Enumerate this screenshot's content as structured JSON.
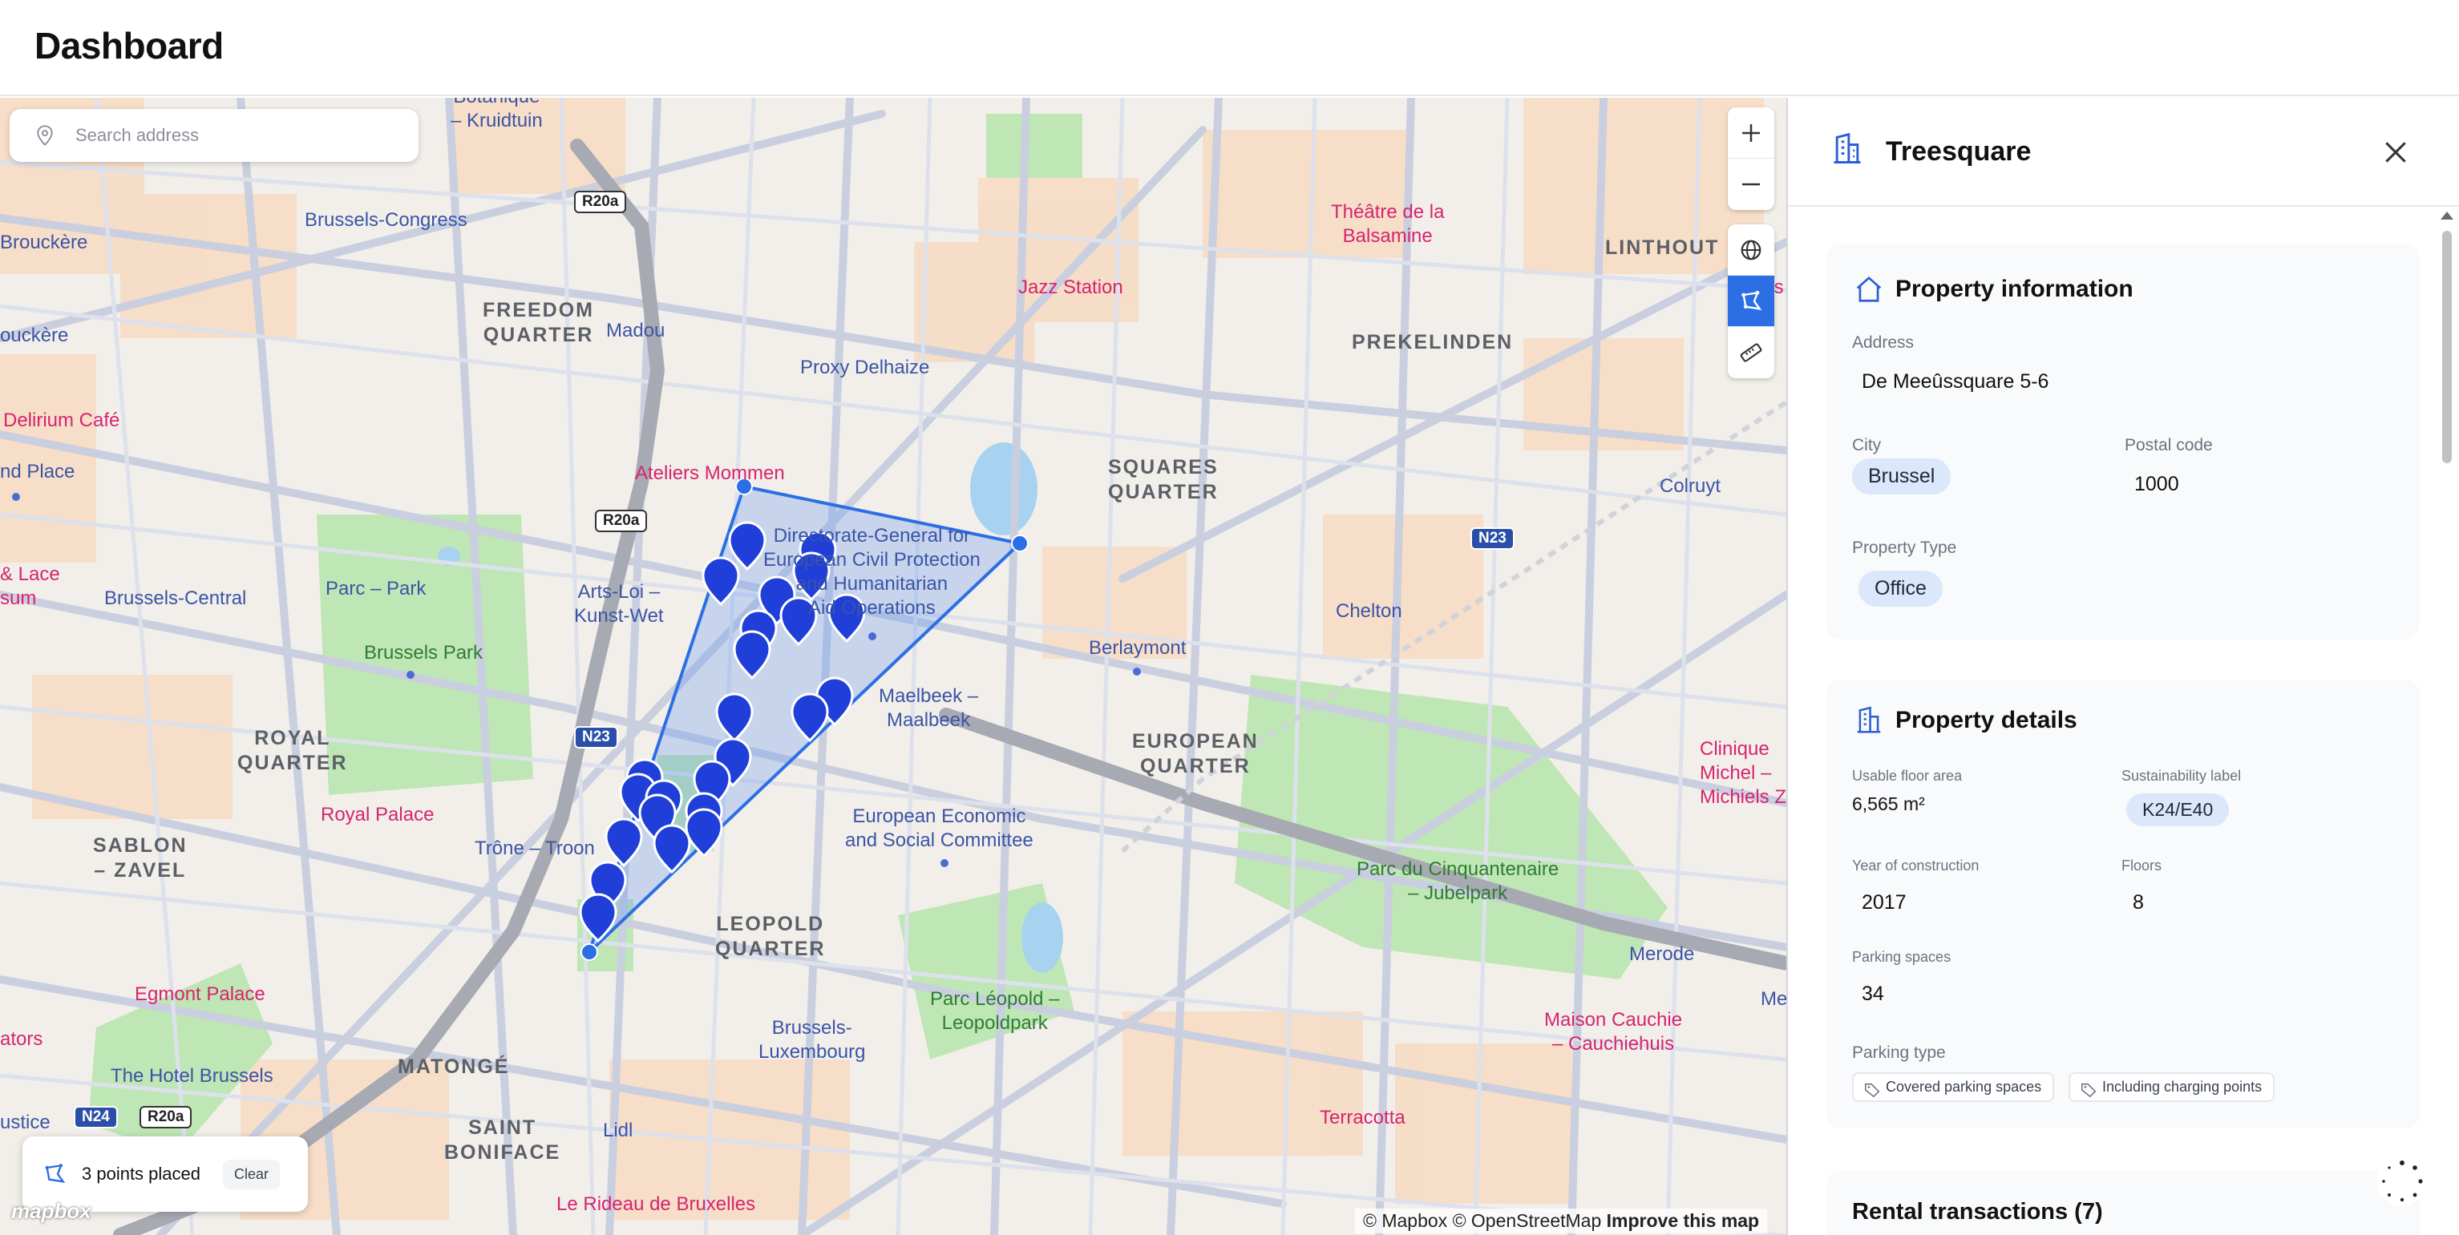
{
  "header": {
    "title": "Dashboard"
  },
  "search": {
    "placeholder": "Search address",
    "icon": "location-pin-icon"
  },
  "map_controls": {
    "items": [
      {
        "name": "zoom-in",
        "icon": "plus-icon"
      },
      {
        "name": "zoom-out",
        "icon": "minus-icon"
      },
      {
        "name": "globe",
        "icon": "globe-icon"
      },
      {
        "name": "draw-polygon",
        "icon": "polygon-draw-icon",
        "active": true
      },
      {
        "name": "measure",
        "icon": "ruler-icon"
      }
    ]
  },
  "map": {
    "labels": {
      "bolanique": "Botanique\n– Kruidtuin",
      "brouckere": "Brouckère",
      "brouckere2": "ouckère",
      "brussels_congress": "Brussels-Congress",
      "freedom_quarter": "FREEDOM\nQUARTER",
      "madou": "Madou",
      "delirium": "Delirium Café",
      "nd_place": "nd Place",
      "proxy_delhaize": "Proxy Delhaize",
      "jazz_station": "Jazz Station",
      "theatre": "Théâtre de la\nBalsamine",
      "linthout": "LINTHOUT",
      "los": "L'Os",
      "prekelinden": "PREKELINDEN",
      "ateliers": "Ateliers Mommen",
      "squares_quarter": "SQUARES\nQUARTER",
      "colruyt": "Colruyt",
      "lace": "& Lace\nsum",
      "brussels_central": "Brussels-Central",
      "parc_park": "Parc – Park",
      "arts_loi": "Arts-Loi –\nKunst-Wet",
      "dg": "Directorate-General for\nEuropean Civil Protection\nand Humanitarian\nAid Operations",
      "chelton": "Chelton",
      "brussels_park": "Brussels Park",
      "berlaymont": "Berlaymont",
      "maelbeek": "Maelbeek –\nMaalbeek",
      "royal_quarter": "ROYAL\nQUARTER",
      "european_quarter": "EUROPEAN\nQUARTER",
      "clinique": "Clinique\nMichel –\nMichiels Zie",
      "royal_palace": "Royal Palace",
      "eesc": "European Economic\nand Social Committee",
      "sablon": "SABLON\n– ZAVEL",
      "trone": "Trône – Troon",
      "cinquantenaire": "Parc du Cinquantenaire\n– Jubelpark",
      "leopold_quarter": "LEOPOLD\nQUARTER",
      "merode": "Merode",
      "egmont": "Egmont Palace",
      "parc_leopold": "Parc Léopold –\nLeopoldpark",
      "brussels_luxembourg": "Brussels-\nLuxembourg",
      "me": "Me",
      "ators": "ators",
      "hotel_brussels": "The Hotel Brussels",
      "matonge": "MATONGÉ",
      "maison_cauchie": "Maison Cauchie\n– Cauchiehuis",
      "ustice": "ustice",
      "saint_boniface": "SAINT\nBONIFACE",
      "lidl": "Lidl",
      "terracotta": "Terracotta",
      "rideau": "Le Rideau de Bruxelles"
    },
    "road_badges": [
      "R20a",
      "R20a",
      "N23",
      "N23",
      "N24",
      "R20a"
    ],
    "attribution": {
      "a": "© Mapbox",
      "b": "© OpenStreetMap",
      "c": "Improve this map"
    },
    "logo": "mapbox"
  },
  "points_box": {
    "text": "3 points placed",
    "clear_label": "Clear"
  },
  "panel": {
    "title": "Treesquare",
    "property_information": {
      "title": "Property information",
      "address_label": "Address",
      "address": "De Meeûssquare 5-6",
      "city_label": "City",
      "city": "Brussel",
      "postal_label": "Postal code",
      "postal": "1000",
      "type_label": "Property Type",
      "type": "Office"
    },
    "property_details": {
      "title": "Property details",
      "floor_area_label": "Usable floor area",
      "floor_area": "6,565 m²",
      "sustainability_label": "Sustainability label",
      "sustainability": "K24/E40",
      "year_label": "Year of construction",
      "year": "2017",
      "floors_label": "Floors",
      "floors": "8",
      "parking_label": "Parking spaces",
      "parking": "34",
      "parking_type_label": "Parking type",
      "parking_types": [
        "Covered parking spaces",
        "Including charging points"
      ]
    },
    "rental_title": "Rental transactions (7)"
  }
}
